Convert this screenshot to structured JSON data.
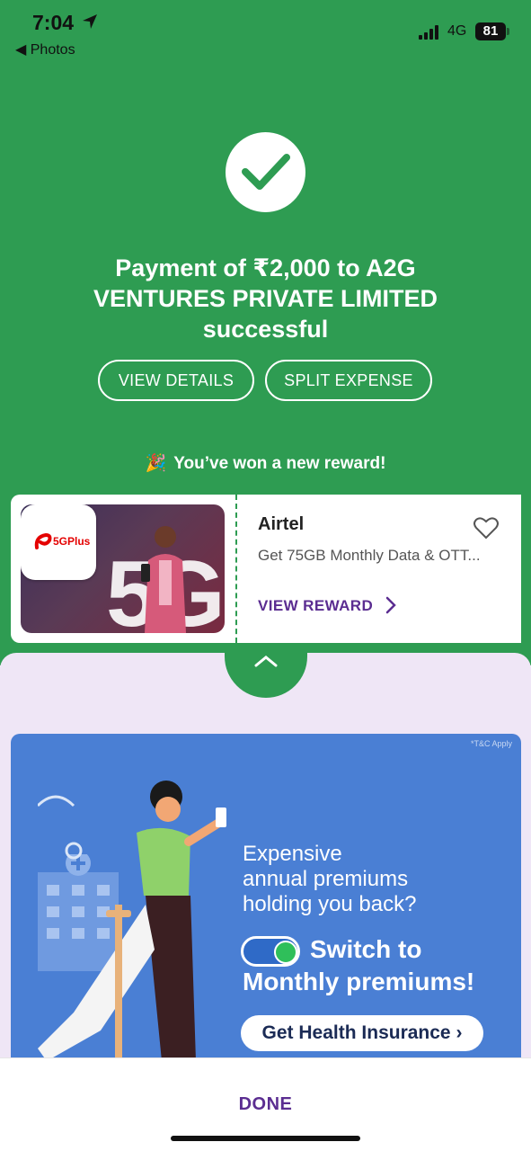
{
  "status_bar": {
    "time": "7:04",
    "back_app": "◀ Photos",
    "network": "4G",
    "battery": "81"
  },
  "payment": {
    "title": "Payment of ₹2,000 to A2G VENTURES PRIVATE LIMITED successful",
    "view_details": "VIEW DETAILS",
    "split_expense": "SPLIT EXPENSE"
  },
  "reward": {
    "message": "You’ve won a new reward!",
    "brand": "Airtel",
    "offer": "Get 75GB Monthly Data & OTT...",
    "view_reward": "VIEW REWARD",
    "badge_text": "5GPlus"
  },
  "banner": {
    "tc": "*T&C Apply",
    "headline_1": "Expensive",
    "headline_2": "annual premiums",
    "headline_3": "holding you back?",
    "switch_text": "Switch to",
    "monthly_text": "Monthly premiums!",
    "cta": "Get Health Insurance ›"
  },
  "footer": {
    "done": "DONE"
  },
  "colors": {
    "success_green": "#2e9c52",
    "accent_purple": "#5b2d91",
    "banner_blue": "#4a7fd4"
  }
}
